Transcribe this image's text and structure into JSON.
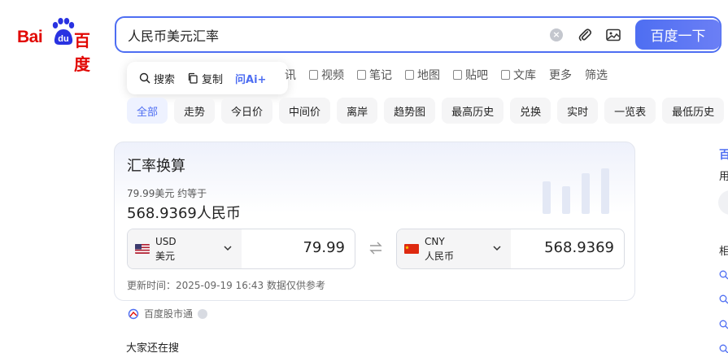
{
  "logo": {
    "left": "Bai",
    "right": "百度",
    "paw": "du"
  },
  "search": {
    "query": "人民币美元汇率",
    "button_label": "百度一下"
  },
  "popup": {
    "search_label": "搜索",
    "copy_label": "复制",
    "ai_label": "问Ai+"
  },
  "nav_tabs": [
    {
      "label": "讯",
      "icon": ""
    },
    {
      "label": "视频",
      "icon": "video-icon"
    },
    {
      "label": "笔记",
      "icon": "note-icon"
    },
    {
      "label": "地图",
      "icon": "map-icon"
    },
    {
      "label": "贴吧",
      "icon": "tieba-icon"
    },
    {
      "label": "文库",
      "icon": "doc-icon"
    },
    {
      "label": "更多",
      "icon": ""
    },
    {
      "label": "筛选",
      "icon": ""
    }
  ],
  "chips": [
    "全部",
    "走势",
    "今日价",
    "中间价",
    "离岸",
    "趋势图",
    "最高历史",
    "兑换",
    "实时",
    "一览表",
    "最低历史"
  ],
  "converter": {
    "title": "汇率换算",
    "subtitle": "79.99美元 约等于",
    "result": "568.9369人民币",
    "from": {
      "code": "USD",
      "name": "美元",
      "amount": "79.99"
    },
    "to": {
      "code": "CNY",
      "name": "人民币",
      "amount": "568.9369"
    },
    "update_time": "更新时间：2025-09-19 16:43 数据仅供参考"
  },
  "source": {
    "label": "百度股市通"
  },
  "also_search": "大家还在搜",
  "right_column": {
    "title": "百",
    "sub": "用",
    "label": "相"
  },
  "colors": {
    "accent": "#4e6ef2",
    "logo_red": "#e10601",
    "blue": "#2932e1"
  }
}
